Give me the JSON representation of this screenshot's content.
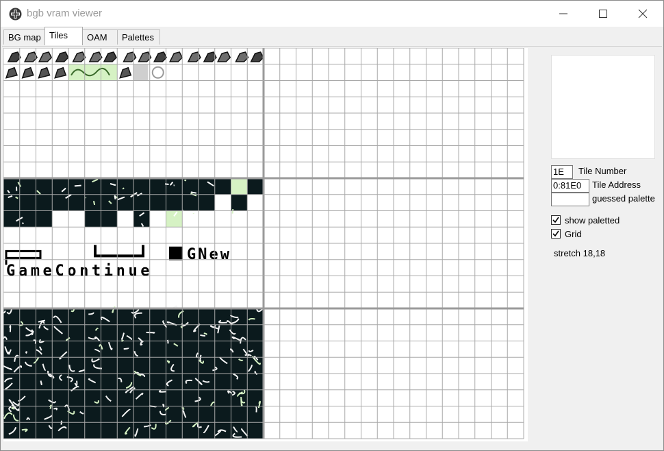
{
  "window": {
    "title": "bgb vram viewer",
    "app_icon": "bgb-cross-icon",
    "controls": [
      "minimize-icon",
      "maximize-icon",
      "close-icon"
    ]
  },
  "tabs": [
    {
      "label": "BG map",
      "active": false
    },
    {
      "label": "Tiles",
      "active": true
    },
    {
      "label": "OAM",
      "active": false
    },
    {
      "label": "Palettes",
      "active": false
    }
  ],
  "tile_text": {
    "row_a": "GNew",
    "row_b": "GameContinue"
  },
  "side": {
    "tile_number_value": "1E",
    "tile_number_label": "Tile Number",
    "tile_address_value": "0:81E0",
    "tile_address_label": "Tile Address",
    "guessed_palette_value": "",
    "guessed_palette_label": "guessed palette",
    "show_paletted_label": "show paletted",
    "show_paletted_checked": true,
    "grid_label": "Grid",
    "grid_checked": true,
    "stretch_text": "stretch 18,18"
  },
  "colors": {
    "dark_tile": "#0b1a1d",
    "light_green": "#d6f2c4",
    "grid_line": "#a8a8a8",
    "block_divider": "#9a9a9a"
  }
}
